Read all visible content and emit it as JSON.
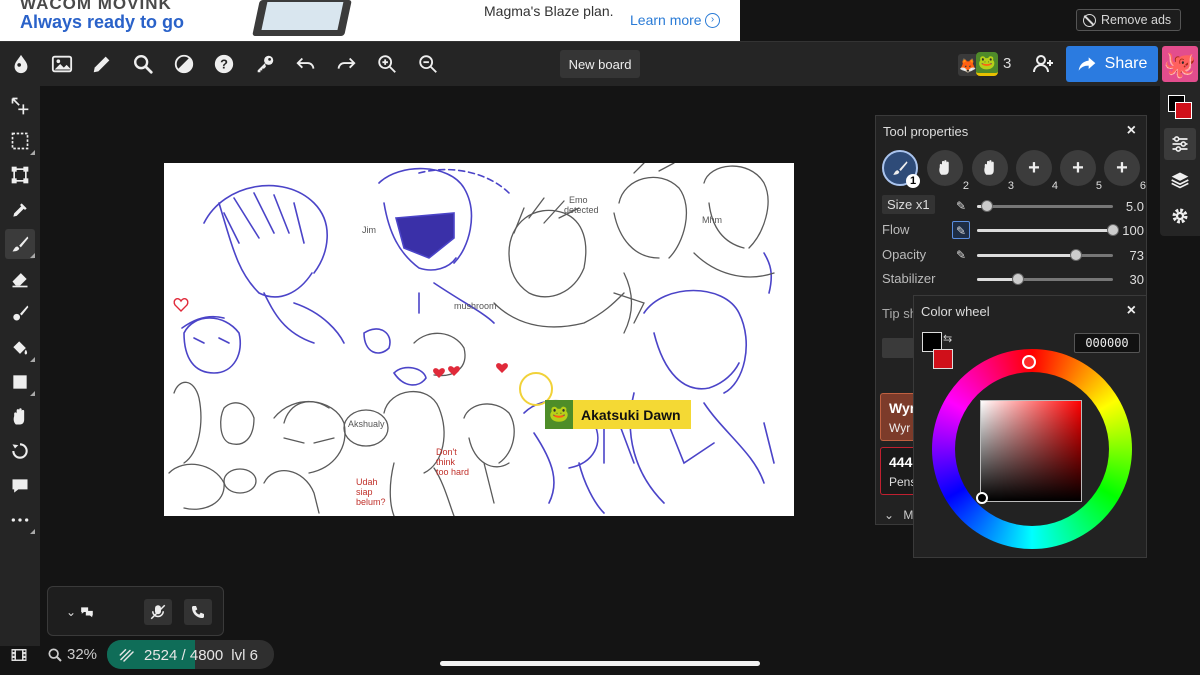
{
  "ad": {
    "brand": "WACOM MOVINK",
    "tagline": "Always ready to go",
    "plan_text": "Magma's Blaze plan.",
    "learn_more": "Learn more",
    "remove_ads": "Remove ads"
  },
  "topbar": {
    "board_name": "New board",
    "user_count": "3",
    "share_label": "Share"
  },
  "tool_properties": {
    "title": "Tool properties",
    "close": "×",
    "brush_slots": [
      {
        "icon": "brush-icon",
        "num": "1",
        "selected": true
      },
      {
        "icon": "hand-icon",
        "num": "2"
      },
      {
        "icon": "hand-icon",
        "num": "3"
      },
      {
        "icon": "plus-icon",
        "num": "4"
      },
      {
        "icon": "plus-icon",
        "num": "5"
      },
      {
        "icon": "plus-icon",
        "num": "6"
      }
    ],
    "size_label": "Size x1",
    "size_value": "5.0",
    "size_fraction": 0.07,
    "flow_label": "Flow",
    "flow_value": "100",
    "flow_fraction": 1.0,
    "opacity_label": "Opacity",
    "opacity_value": "73",
    "opacity_fraction": 0.73,
    "stabilizer_label": "Stabilizer",
    "stabilizer_value": "30",
    "stabilizer_fraction": 0.3,
    "tip_label": "Tip sh",
    "brush_card_1_title": "Wyr",
    "brush_card_1_sub": "Wyr",
    "brush_card_2_title": "444",
    "brush_card_2_sub": "Pens",
    "more_label": "M"
  },
  "color_wheel": {
    "title": "Color wheel",
    "close": "×",
    "hex": "000000",
    "primary_color": "#000000",
    "secondary_color": "#d0101a"
  },
  "canvas": {
    "collaborator_name": "Akatsuki Dawn"
  },
  "status": {
    "zoom": "32%",
    "progress": "2524 / 4800",
    "progress_fraction": 0.526,
    "level": "lvl 6"
  },
  "colors": {
    "share_blue": "#2b7be0",
    "progress_green": "#0f6d58",
    "user_tag_yellow": "#f4d934"
  }
}
